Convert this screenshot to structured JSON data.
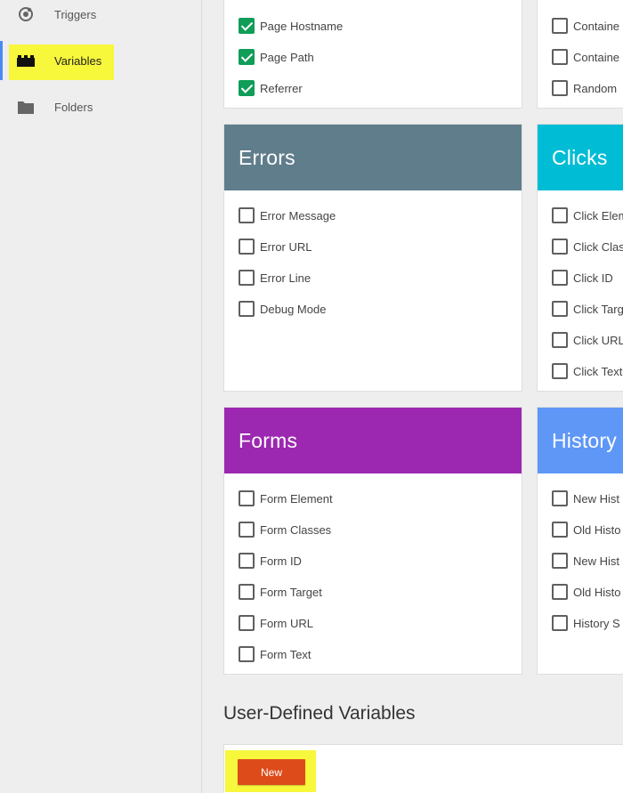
{
  "sidebar": {
    "items": [
      {
        "label": "Triggers",
        "icon": "triggers-icon"
      },
      {
        "label": "Variables",
        "icon": "variables-icon"
      },
      {
        "label": "Folders",
        "icon": "folder-icon"
      }
    ]
  },
  "pages_card": {
    "items": [
      {
        "label": "Page Hostname",
        "checked": true
      },
      {
        "label": "Page Path",
        "checked": true
      },
      {
        "label": "Referrer",
        "checked": true
      }
    ]
  },
  "utilities_card": {
    "items": [
      {
        "label": "Containe",
        "checked": false
      },
      {
        "label": "Containe",
        "checked": false
      },
      {
        "label": "Random",
        "checked": false
      }
    ]
  },
  "errors_card": {
    "title": "Errors",
    "color": "#607d8b",
    "items": [
      {
        "label": "Error Message",
        "checked": false
      },
      {
        "label": "Error URL",
        "checked": false
      },
      {
        "label": "Error Line",
        "checked": false
      },
      {
        "label": "Debug Mode",
        "checked": false
      }
    ]
  },
  "clicks_card": {
    "title": "Clicks",
    "color": "#00bcd4",
    "items": [
      {
        "label": "Click Elem",
        "checked": false
      },
      {
        "label": "Click Clas",
        "checked": false
      },
      {
        "label": "Click ID",
        "checked": false
      },
      {
        "label": "Click Targ",
        "checked": false
      },
      {
        "label": "Click URL",
        "checked": false
      },
      {
        "label": "Click Text",
        "checked": false
      }
    ]
  },
  "forms_card": {
    "title": "Forms",
    "color": "#9c27b0",
    "items": [
      {
        "label": "Form Element",
        "checked": false
      },
      {
        "label": "Form Classes",
        "checked": false
      },
      {
        "label": "Form ID",
        "checked": false
      },
      {
        "label": "Form Target",
        "checked": false
      },
      {
        "label": "Form URL",
        "checked": false
      },
      {
        "label": "Form Text",
        "checked": false
      }
    ]
  },
  "history_card": {
    "title": "History",
    "color": "#5e97f6",
    "items": [
      {
        "label": "New Hist",
        "checked": false
      },
      {
        "label": "Old Histo",
        "checked": false
      },
      {
        "label": "New Hist",
        "checked": false
      },
      {
        "label": "Old Histo",
        "checked": false
      },
      {
        "label": "History S",
        "checked": false
      }
    ]
  },
  "user_defined": {
    "title": "User-Defined Variables",
    "new_label": "New"
  }
}
